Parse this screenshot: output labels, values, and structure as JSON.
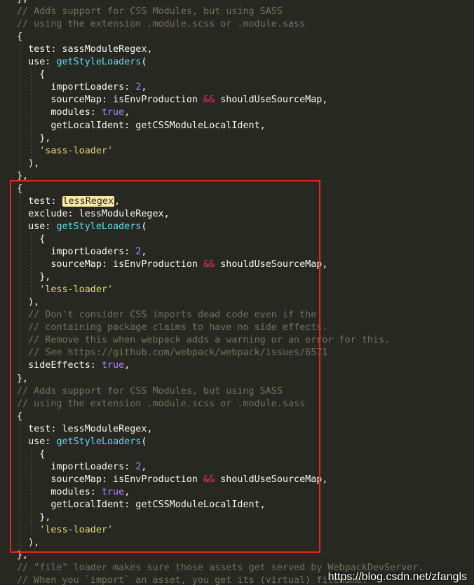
{
  "code": {
    "lines": [
      [
        {
          "t": "},",
          "c": "plain"
        }
      ],
      [
        {
          "t": "// Adds support for CSS Modules, but using SASS",
          "c": "comment"
        }
      ],
      [
        {
          "t": "// using the extension .module.scss or .module.sass",
          "c": "comment"
        }
      ],
      [
        {
          "t": "{",
          "c": "plain"
        }
      ],
      [
        {
          "t": "  test: sassModuleRegex,",
          "c": "plain"
        }
      ],
      [
        {
          "t": "  use: ",
          "c": "plain"
        },
        {
          "t": "getStyleLoaders",
          "c": "func"
        },
        {
          "t": "(",
          "c": "plain"
        }
      ],
      [
        {
          "t": "    {",
          "c": "plain"
        }
      ],
      [
        {
          "t": "      importLoaders: ",
          "c": "plain"
        },
        {
          "t": "2",
          "c": "num"
        },
        {
          "t": ",",
          "c": "plain"
        }
      ],
      [
        {
          "t": "      sourceMap: isEnvProduction ",
          "c": "plain"
        },
        {
          "t": "&&",
          "c": "op"
        },
        {
          "t": " shouldUseSourceMap,",
          "c": "plain"
        }
      ],
      [
        {
          "t": "      modules: ",
          "c": "plain"
        },
        {
          "t": "true",
          "c": "bool"
        },
        {
          "t": ",",
          "c": "plain"
        }
      ],
      [
        {
          "t": "      getLocalIdent: getCSSModuleLocalIdent,",
          "c": "plain"
        }
      ],
      [
        {
          "t": "    },",
          "c": "plain"
        }
      ],
      [
        {
          "t": "    ",
          "c": "plain"
        },
        {
          "t": "'sass-loader'",
          "c": "str"
        }
      ],
      [
        {
          "t": "  ),",
          "c": "plain"
        }
      ],
      [
        {
          "t": "},",
          "c": "plain"
        }
      ],
      [
        {
          "t": "{",
          "c": "plain"
        }
      ],
      [
        {
          "t": "  test: ",
          "c": "plain"
        },
        {
          "t": "lessRegex",
          "c": "hl"
        },
        {
          "t": ",",
          "c": "plain"
        }
      ],
      [
        {
          "t": "  exclude: lessModuleRegex,",
          "c": "plain"
        }
      ],
      [
        {
          "t": "  use: ",
          "c": "plain"
        },
        {
          "t": "getStyleLoaders",
          "c": "func"
        },
        {
          "t": "(",
          "c": "plain"
        }
      ],
      [
        {
          "t": "    {",
          "c": "plain"
        }
      ],
      [
        {
          "t": "      importLoaders: ",
          "c": "plain"
        },
        {
          "t": "2",
          "c": "num"
        },
        {
          "t": ",",
          "c": "plain"
        }
      ],
      [
        {
          "t": "      sourceMap: isEnvProduction ",
          "c": "plain"
        },
        {
          "t": "&&",
          "c": "op"
        },
        {
          "t": " shouldUseSourceMap,",
          "c": "plain"
        }
      ],
      [
        {
          "t": "    },",
          "c": "plain"
        }
      ],
      [
        {
          "t": "    ",
          "c": "plain"
        },
        {
          "t": "'less-loader'",
          "c": "str"
        }
      ],
      [
        {
          "t": "  ),",
          "c": "plain"
        }
      ],
      [
        {
          "t": "  // Don't consider CSS imports dead code even if the",
          "c": "comment"
        }
      ],
      [
        {
          "t": "  // containing package claims to have no side effects.",
          "c": "comment"
        }
      ],
      [
        {
          "t": "  // Remove this when webpack adds a warning or an error for this.",
          "c": "comment"
        }
      ],
      [
        {
          "t": "  // See https://github.com/webpack/webpack/issues/6571",
          "c": "comment"
        }
      ],
      [
        {
          "t": "  sideEffects: ",
          "c": "plain"
        },
        {
          "t": "true",
          "c": "bool"
        },
        {
          "t": ",",
          "c": "plain"
        }
      ],
      [
        {
          "t": "},",
          "c": "plain"
        }
      ],
      [
        {
          "t": "// Adds support for CSS Modules, but using SASS",
          "c": "comment"
        }
      ],
      [
        {
          "t": "// using the extension .module.scss or .module.sass",
          "c": "comment"
        }
      ],
      [
        {
          "t": "{",
          "c": "plain"
        }
      ],
      [
        {
          "t": "  test: lessModuleRegex,",
          "c": "plain"
        }
      ],
      [
        {
          "t": "  use: ",
          "c": "plain"
        },
        {
          "t": "getStyleLoaders",
          "c": "func"
        },
        {
          "t": "(",
          "c": "plain"
        }
      ],
      [
        {
          "t": "    {",
          "c": "plain"
        }
      ],
      [
        {
          "t": "      importLoaders: ",
          "c": "plain"
        },
        {
          "t": "2",
          "c": "num"
        },
        {
          "t": ",",
          "c": "plain"
        }
      ],
      [
        {
          "t": "      sourceMap: isEnvProduction ",
          "c": "plain"
        },
        {
          "t": "&&",
          "c": "op"
        },
        {
          "t": " shouldUseSourceMap,",
          "c": "plain"
        }
      ],
      [
        {
          "t": "      modules: ",
          "c": "plain"
        },
        {
          "t": "true",
          "c": "bool"
        },
        {
          "t": ",",
          "c": "plain"
        }
      ],
      [
        {
          "t": "      getLocalIdent: getCSSModuleLocalIdent,",
          "c": "plain"
        }
      ],
      [
        {
          "t": "    },",
          "c": "plain"
        }
      ],
      [
        {
          "t": "    ",
          "c": "plain"
        },
        {
          "t": "'less-loader'",
          "c": "str"
        }
      ],
      [
        {
          "t": "  ),",
          "c": "plain"
        }
      ],
      [
        {
          "t": "},",
          "c": "plain"
        }
      ],
      [
        {
          "t": "// \"file\" loader makes sure those assets get served by WebpackDevServer.",
          "c": "comment"
        }
      ],
      [
        {
          "t": "// When you `import` an asset, you get its (virtual) filename.",
          "c": "comment"
        }
      ]
    ]
  },
  "watermark": "https://blog.csdn.net/zfangls",
  "colors": {
    "background": "#272822",
    "comment": "#75715e",
    "function": "#66d9ef",
    "number": "#ae81ff",
    "string": "#e6db74",
    "operator": "#f92672",
    "highlight": "#ffe8a3",
    "annotation_box": "#e8231f"
  }
}
